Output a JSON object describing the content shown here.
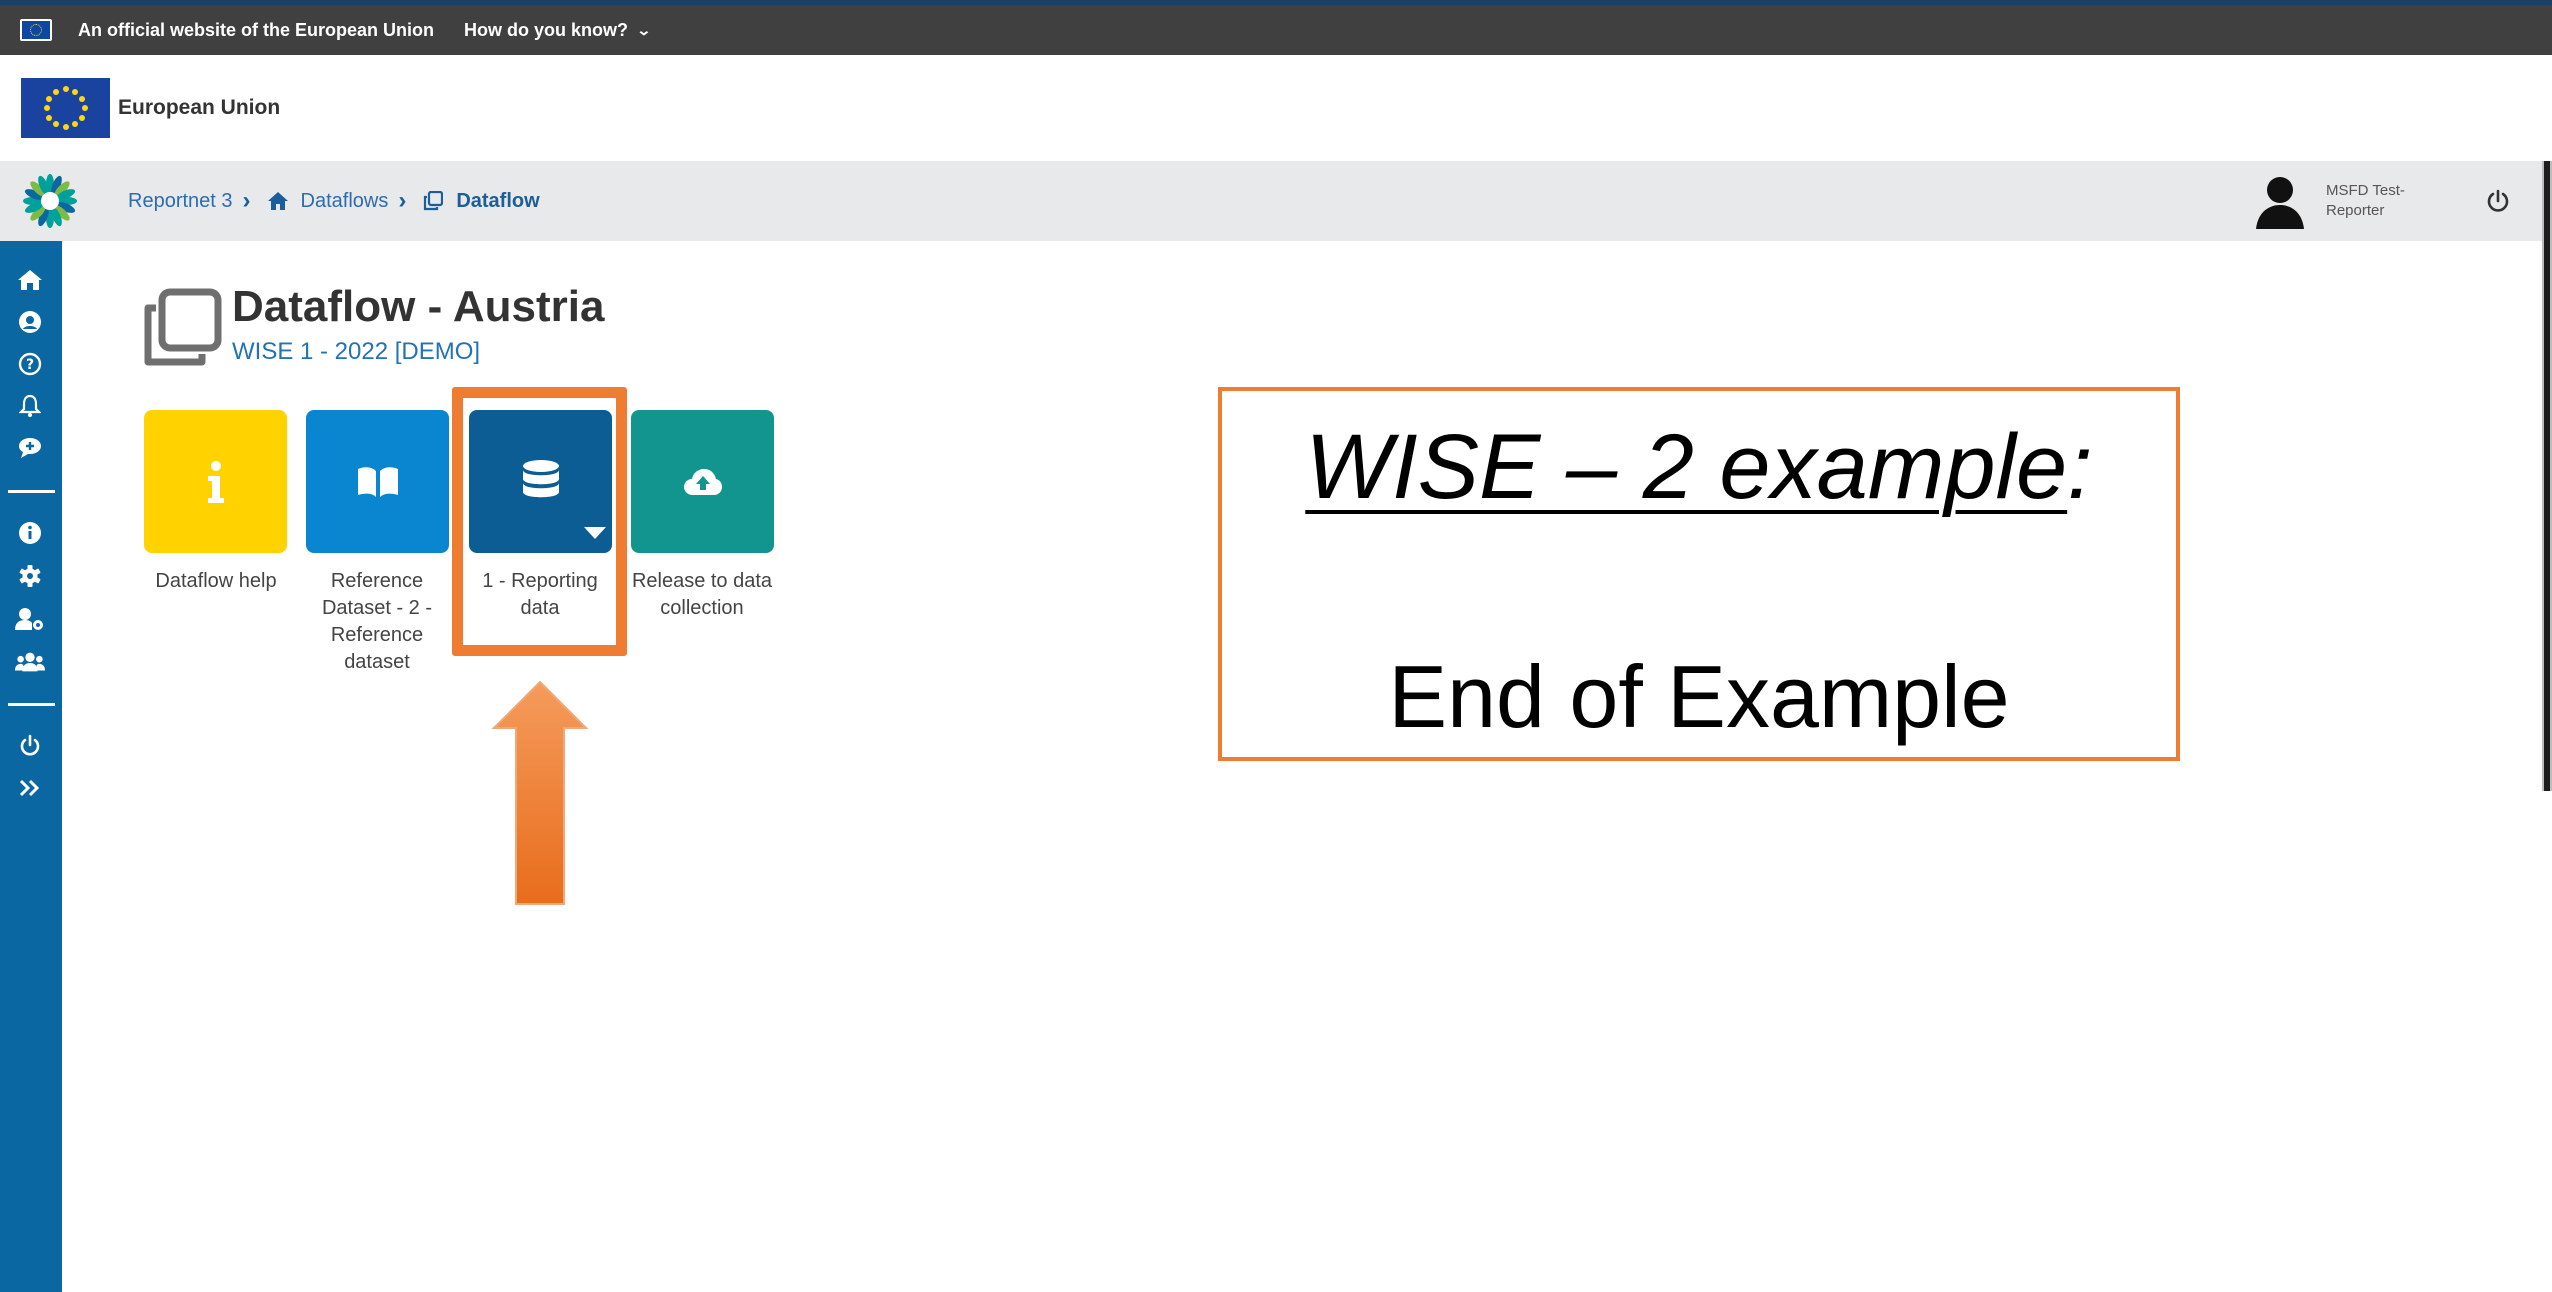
{
  "eu_banner": {
    "official_text": "An official website of the European Union",
    "how_text": "How do you know?"
  },
  "eu_header": {
    "title": "European Union"
  },
  "breadcrumb": {
    "items": [
      {
        "label": "Reportnet 3",
        "icon": "none"
      },
      {
        "label": "Dataflows",
        "icon": "home-icon"
      },
      {
        "label": "Dataflow",
        "icon": "clone-icon",
        "current": true
      }
    ]
  },
  "user": {
    "name": "MSFD Test-Reporter"
  },
  "sidebar": {
    "items": [
      "home-icon",
      "user-circle-icon",
      "question-icon",
      "bell-icon",
      "comment-plus-icon",
      "info-icon",
      "gear-icon",
      "user-cog-icon",
      "users-icon",
      "power-icon",
      "double-chevron-right-icon"
    ]
  },
  "page": {
    "title": "Dataflow - Austria",
    "subtitle": "WISE 1 - 2022 [DEMO]"
  },
  "tiles": [
    {
      "label": "Dataflow help",
      "color": "#ffd200",
      "icon": "info-icon"
    },
    {
      "label": "Reference Dataset - 2 - Reference dataset",
      "color": "#0a86d0",
      "icon": "book-open-icon"
    },
    {
      "label": "1 - Reporting data",
      "color": "#0b5d94",
      "icon": "database-icon"
    },
    {
      "label": "Release to data collection",
      "color": "#12958e",
      "icon": "cloud-upload-icon"
    }
  ],
  "callout": {
    "title_main": "WISE – 2  example",
    "title_colon": ":",
    "body": "End of Example"
  },
  "colors": {
    "accent_orange": "#ef7d31",
    "sidebar_blue": "#0b67a2",
    "link_blue": "#2d6cae"
  }
}
